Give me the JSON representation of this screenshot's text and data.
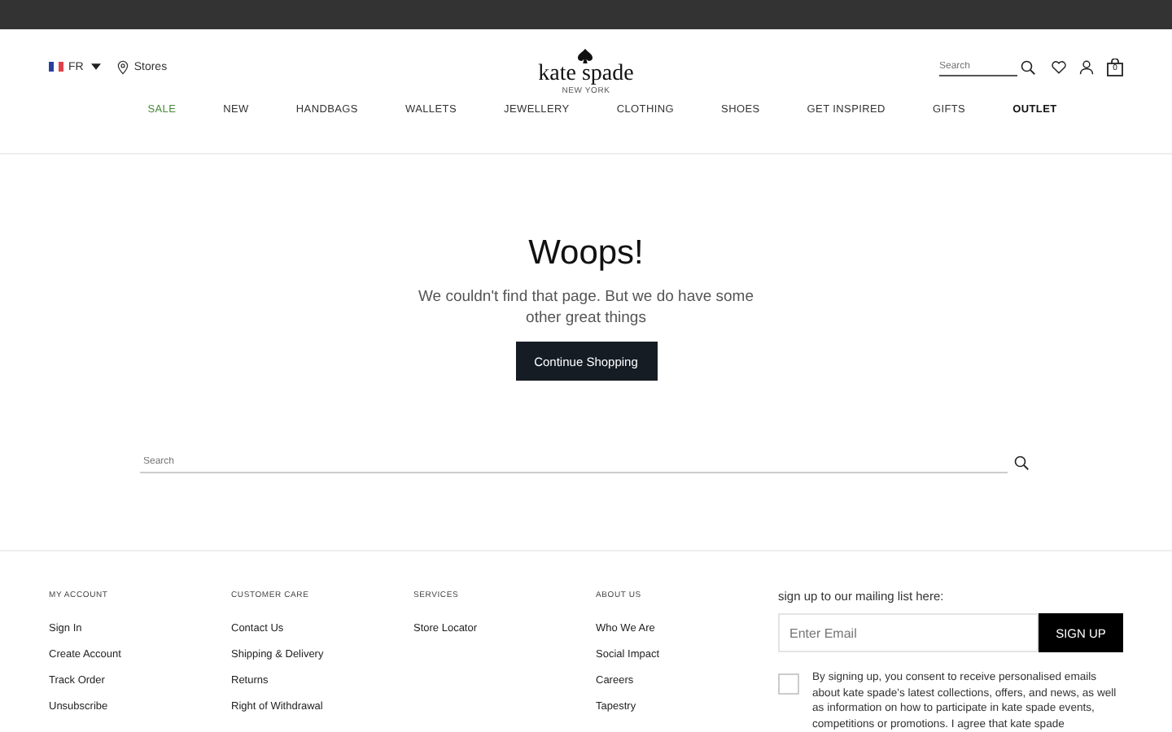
{
  "header": {
    "language": "FR",
    "stores": "Stores",
    "logo": "kate spade",
    "logo_sub": "NEW YORK",
    "search": {
      "placeholder": "Search"
    },
    "cart_count": "0"
  },
  "nav": [
    {
      "label": "SALE",
      "kind": "sale"
    },
    {
      "label": "NEW",
      "kind": "normal"
    },
    {
      "label": "HANDBAGS",
      "kind": "normal"
    },
    {
      "label": "WALLETS",
      "kind": "normal"
    },
    {
      "label": "JEWELLERY",
      "kind": "normal"
    },
    {
      "label": "CLOTHING",
      "kind": "normal"
    },
    {
      "label": "SHOES",
      "kind": "normal"
    },
    {
      "label": "GET INSPIRED",
      "kind": "normal"
    },
    {
      "label": "GIFTS",
      "kind": "normal"
    },
    {
      "label": "OUTLET",
      "kind": "outlet"
    }
  ],
  "error": {
    "title": "Woops!",
    "message": "We couldn't find that page. But we do have some other great things",
    "button": "Continue Shopping"
  },
  "page_search": {
    "placeholder": "Search"
  },
  "footer": {
    "columns": [
      {
        "heading": "MY ACCOUNT",
        "links": [
          "Sign In",
          "Create Account",
          "Track Order",
          "Unsubscribe"
        ]
      },
      {
        "heading": "CUSTOMER CARE",
        "links": [
          "Contact Us",
          "Shipping & Delivery",
          "Returns",
          "Right of Withdrawal"
        ]
      },
      {
        "heading": "SERVICES",
        "links": [
          "Store Locator"
        ]
      },
      {
        "heading": "ABOUT US",
        "links": [
          "Who We Are",
          "Social Impact",
          "Careers",
          "Tapestry"
        ]
      }
    ],
    "newsletter": {
      "label": "sign up to our mailing list here:",
      "placeholder": "Enter Email",
      "button": "SIGN UP",
      "consent_checked": false,
      "consent": "By signing up, you consent to receive personalised emails about kate spade's latest collections, offers, and news, as well as information on how to participate in kate spade events, competitions or promotions. I agree that kate spade"
    }
  }
}
